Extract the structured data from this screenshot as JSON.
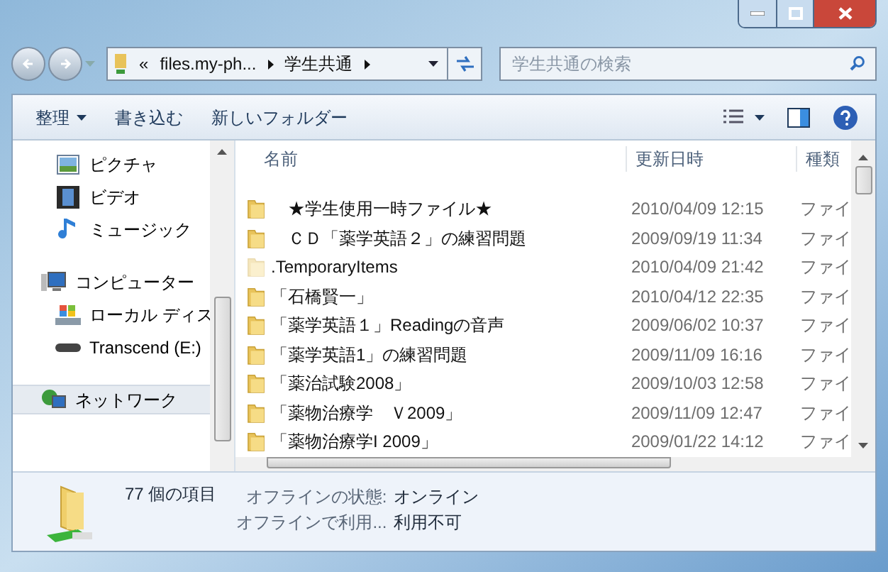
{
  "address": {
    "crumbs": [
      "«",
      "files.my-ph...",
      "学生共通"
    ]
  },
  "search": {
    "placeholder": "学生共通の検索"
  },
  "toolbar": {
    "buttons": [
      {
        "label": "整理",
        "dropdown": true
      },
      {
        "label": "書き込む",
        "dropdown": false
      },
      {
        "label": "新しいフォルダー",
        "dropdown": false
      }
    ]
  },
  "sidebar": {
    "items": [
      {
        "label": "ピクチャ",
        "kind": "pictures",
        "indent": true,
        "selected": false
      },
      {
        "label": "ビデオ",
        "kind": "videos",
        "indent": true,
        "selected": false
      },
      {
        "label": "ミュージック",
        "kind": "music",
        "indent": true,
        "selected": false
      },
      {
        "label": "コンピューター",
        "kind": "computer",
        "indent": false,
        "selected": false
      },
      {
        "label": "ローカル ディス",
        "kind": "disk",
        "indent": true,
        "selected": false
      },
      {
        "label": "Transcend (E:)",
        "kind": "drive",
        "indent": true,
        "selected": false
      },
      {
        "label": "ネットワーク",
        "kind": "network",
        "indent": false,
        "selected": true
      }
    ]
  },
  "table": {
    "columns": [
      "名前",
      "更新日時",
      "種類"
    ],
    "rows": [
      {
        "name": "　★学生使用一時ファイル★",
        "date": "2010/04/09 12:15",
        "type": "ファイ",
        "hidden": false
      },
      {
        "name": "　ＣＤ「薬学英語２」の練習問題",
        "date": "2009/09/19 11:34",
        "type": "ファイ",
        "hidden": false
      },
      {
        "name": ".TemporaryItems",
        "date": "2010/04/09 21:42",
        "type": "ファイ",
        "hidden": true
      },
      {
        "name": "「石橋賢一」",
        "date": "2010/04/12 22:35",
        "type": "ファイ",
        "hidden": false
      },
      {
        "name": "「薬学英語１」Readingの音声",
        "date": "2009/06/02 10:37",
        "type": "ファイ",
        "hidden": false
      },
      {
        "name": "「薬学英語1」の練習問題",
        "date": "2009/11/09 16:16",
        "type": "ファイ",
        "hidden": false
      },
      {
        "name": "「薬治試験2008」",
        "date": "2009/10/03 12:58",
        "type": "ファイ",
        "hidden": false
      },
      {
        "name": "「薬物治療学　Ｖ2009」",
        "date": "2009/11/09 12:47",
        "type": "ファイ",
        "hidden": false
      },
      {
        "name": "「薬物治療学I 2009」",
        "date": "2009/01/22 14:12",
        "type": "ファイ",
        "hidden": false
      }
    ]
  },
  "details": {
    "count": "77 個の項目",
    "fields": [
      {
        "label": "オフラインの状態:",
        "value": "オンライン"
      },
      {
        "label": "オフラインで利用...",
        "value": "利用不可"
      }
    ]
  }
}
